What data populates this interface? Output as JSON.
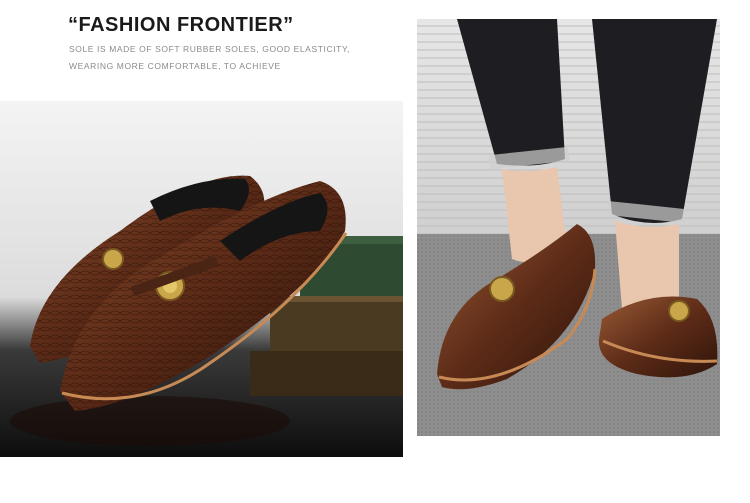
{
  "headline": "“FASHION FRONTIER”",
  "description_line_1": "SOLE IS MADE OF SOFT RUBBER SOLES, GOOD ELASTICITY,",
  "description_line_2": "WEARING MORE COMFORTABLE, TO ACHIEVE",
  "colors": {
    "leather_dark": "#3a1a10",
    "leather_mid": "#6b3520",
    "leather_light": "#9a5a35",
    "buckle_gold": "#c9a64a",
    "jeans": "#1e1e22",
    "floor_carpet": "#8c8c8c"
  }
}
